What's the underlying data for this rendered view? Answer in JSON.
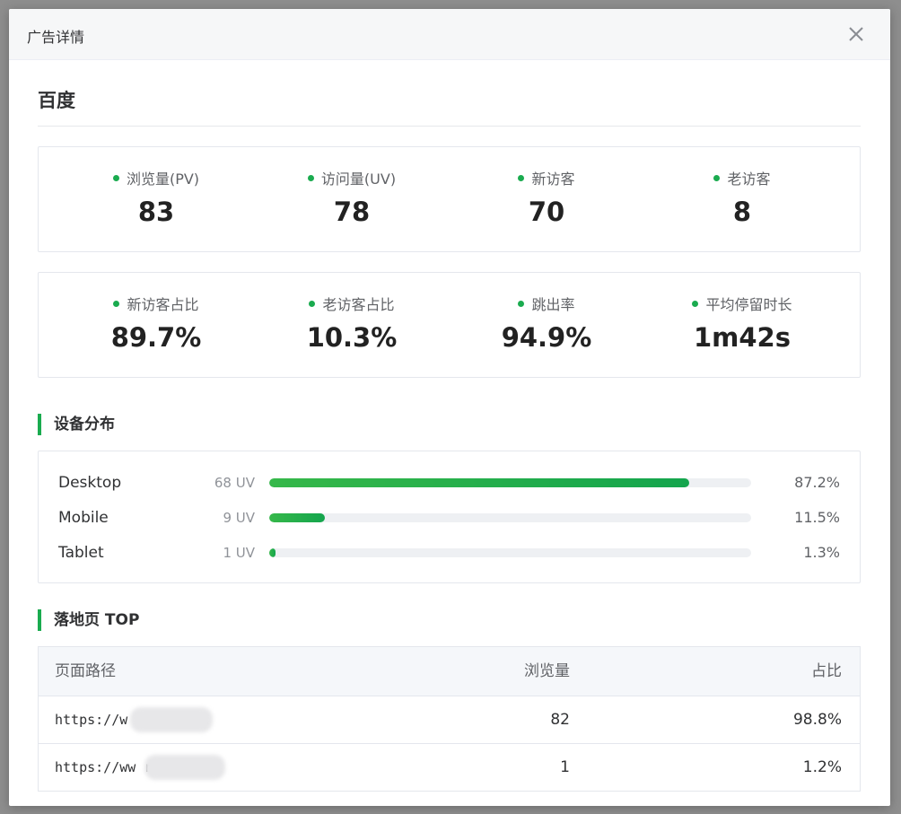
{
  "modal": {
    "title": "广告详情",
    "close_icon": "close-icon"
  },
  "source_name": "百度",
  "stats_row1": [
    {
      "label": "浏览量(PV)",
      "value": "83"
    },
    {
      "label": "访问量(UV)",
      "value": "78"
    },
    {
      "label": "新访客",
      "value": "70"
    },
    {
      "label": "老访客",
      "value": "8"
    }
  ],
  "stats_row2": [
    {
      "label": "新访客占比",
      "value": "89.7%"
    },
    {
      "label": "老访客占比",
      "value": "10.3%"
    },
    {
      "label": "跳出率",
      "value": "94.9%"
    },
    {
      "label": "平均停留时长",
      "value": "1m42s"
    }
  ],
  "device_section": {
    "title": "设备分布",
    "devices": [
      {
        "name": "Desktop",
        "uv": "68 UV",
        "share": 87.2,
        "share_label": "87.2%"
      },
      {
        "name": "Mobile",
        "uv": "9 UV",
        "share": 11.5,
        "share_label": "11.5%"
      },
      {
        "name": "Tablet",
        "uv": "1 UV",
        "share": 1.3,
        "share_label": "1.3%"
      }
    ]
  },
  "landing_section": {
    "title": "落地页 TOP",
    "columns": {
      "path": "页面路径",
      "pv": "浏览量",
      "share": "占比"
    },
    "rows": [
      {
        "path": "https://w        new/down…",
        "pv": "82",
        "share": "98.8%"
      },
      {
        "path": "https://ww         roduct",
        "pv": "1",
        "share": "1.2%"
      }
    ]
  },
  "colors": {
    "accent": "#1aab4f",
    "track": "#eef0f3",
    "header_bg": "#f6f7f8"
  }
}
